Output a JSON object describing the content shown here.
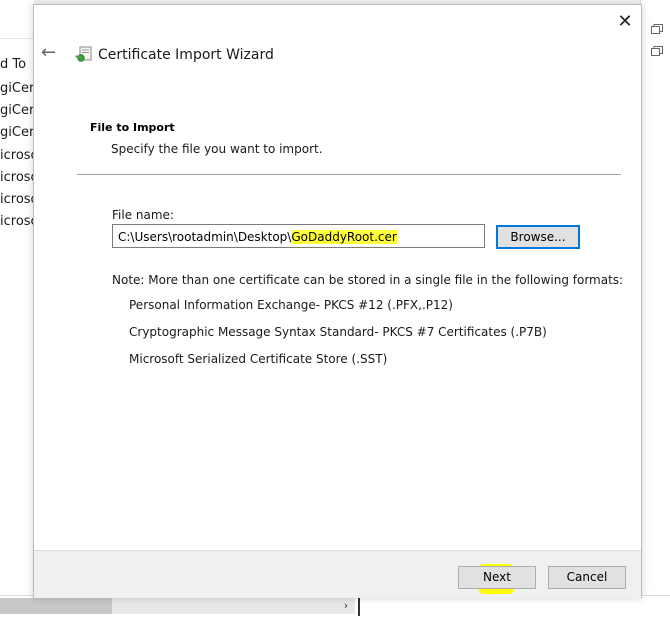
{
  "background": {
    "left_list": [
      "d To",
      "giCert",
      "giCert",
      "giCert",
      "icrosc",
      "icrosc",
      "icrosc",
      "icrosc"
    ],
    "scroll_arrow": "›"
  },
  "dialog": {
    "title": "Certificate Import Wizard",
    "close_glyph": "✕",
    "back_glyph": "←",
    "section_title": "File to Import",
    "section_description": "Specify the file you want to import.",
    "file_name_label": "File name:",
    "file_path_prefix": "C:\\Users\\rootadmin\\Desktop\\",
    "file_path_highlight": "GoDaddyRoot.cer",
    "browse_label": "Browse...",
    "note": "Note:  More than one certificate can be stored in a single file in the following formats:",
    "formats": [
      "Personal Information Exchange- PKCS #12 (.PFX,.P12)",
      "Cryptographic Message Syntax Standard- PKCS #7 Certificates (.P7B)",
      "Microsoft Serialized Certificate Store (.SST)"
    ],
    "next_label": "Next",
    "cancel_label": "Cancel"
  },
  "colors": {
    "accent": "#0078d7",
    "highlight": "#ffff00",
    "footer": "#f0f0f0"
  },
  "icons": [
    "close-icon",
    "back-arrow-icon",
    "certificate-wizard-icon",
    "chevron-right-icon"
  ]
}
